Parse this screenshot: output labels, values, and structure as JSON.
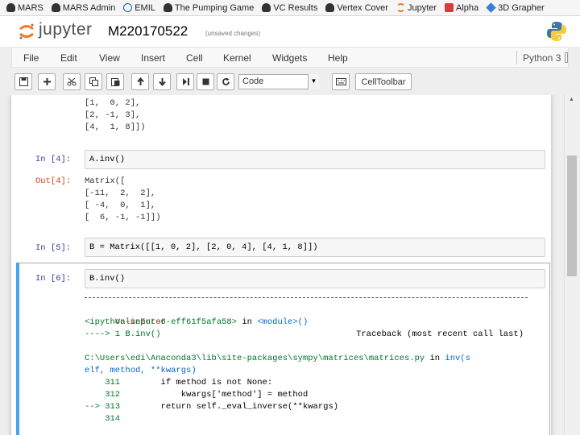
{
  "bookmarks": [
    {
      "label": "MARS",
      "icon": "cap-icon"
    },
    {
      "label": "MARS Admin",
      "icon": "cap-icon"
    },
    {
      "label": "EMIL",
      "icon": "globe-icon"
    },
    {
      "label": "The Pumping Game",
      "icon": "cap-icon"
    },
    {
      "label": "VC Results",
      "icon": "cap-icon"
    },
    {
      "label": "Vertex Cover",
      "icon": "cap-icon"
    },
    {
      "label": "Jupyter",
      "icon": "jupyter-icon"
    },
    {
      "label": "Alpha",
      "icon": "wolfram-icon"
    },
    {
      "label": "3D Grapher",
      "icon": "cube-icon"
    }
  ],
  "header": {
    "logo_text": "jupyter",
    "notebook_title": "M220170522",
    "save_status": "(unsaved changes)"
  },
  "menu": {
    "items": [
      "File",
      "Edit",
      "View",
      "Insert",
      "Cell",
      "Kernel",
      "Widgets",
      "Help"
    ],
    "kernel_name": "Python 3"
  },
  "toolbar": {
    "cell_type": "Code",
    "cell_toolbar_label": "CellToolbar"
  },
  "cells": {
    "c3_out_lines": [
      "[1,  0, 2],",
      "[2, -1, 3],",
      "[4,  1, 8]])"
    ],
    "c4_prompt": "In [4]:",
    "c4_code": "A.inv()",
    "c4_out_prompt": "Out[4]:",
    "c4_out_lines": [
      "Matrix([",
      "[-11,  2,  2],",
      "[ -4,  0,  1],",
      "[  6, -1, -1]])"
    ],
    "c5_prompt": "In [5]:",
    "c5_code": "B = Matrix([[1, 0, 2], [2, 0, 4], [4, 1, 8]])",
    "c6_prompt": "In [6]:",
    "c6_code": "B.inv()"
  },
  "traceback": {
    "error_name": "ValueError",
    "header_right": "Traceback (most recent call last)",
    "line_input": "<ipython-input-6-eff61f5afa58>",
    "line_input_in": " in ",
    "line_module": "<module>()",
    "arrow_line": "----> 1 B.inv()",
    "file_path": "C:\\Users\\edi\\Anaconda3\\lib\\site-packages\\sympy\\matrices\\matrices.py",
    "file_in": " in ",
    "file_func": "inv(s",
    "file_cont": "elf, method, **kwargs)",
    "l311_num": "    311",
    "l311_code": "        if method is not None:",
    "l312_num": "    312",
    "l312_code": "            kwargs['method'] = method",
    "l313_num": "--> 313",
    "l313_code": "        return self._eval_inverse(**kwargs)",
    "l314_num": "    314"
  },
  "colors": {
    "prompt_in": "#303f9f",
    "prompt_out": "#d84315",
    "selected_cell": "#42a5f5",
    "jupyter_orange": "#f37726"
  }
}
